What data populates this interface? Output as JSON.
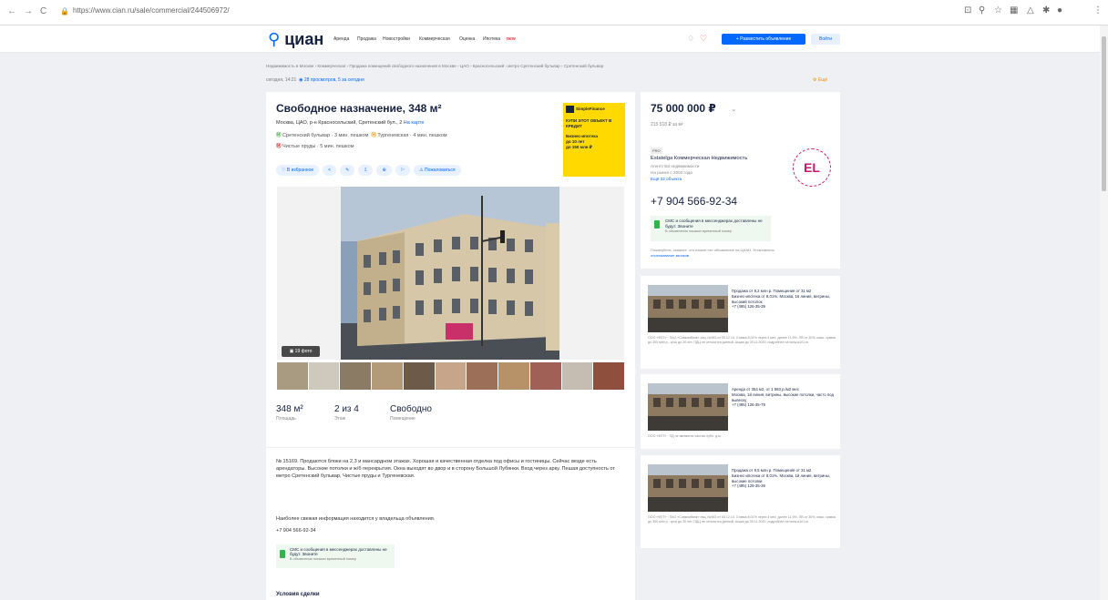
{
  "browser": {
    "url": "https://www.cian.ru/sale/commercial/244506972/",
    "back": "←",
    "forward": "→",
    "reload": "C"
  },
  "header": {
    "logo": "циан",
    "menu": [
      "Аренда",
      "Продажа",
      "Новостройки",
      "Коммерческая",
      "Оценка",
      "Ипотека"
    ],
    "new_badge": "new",
    "post_button": "+ Разместить объявление",
    "login_button": "Войти"
  },
  "breadcrumb": "Недвижимость в Москве › Коммерческая › Продажа помещений свободного назначения в Москве › ЦАО › Красносельский › метро Сретенский бульвар › Сретенский бульвар",
  "meta": {
    "date": "сегодня, 14:21",
    "views": "28 просмотров, 5 за сегодня",
    "favorite": "Ещё"
  },
  "listing": {
    "title": "Свободное назначение, 348 м²",
    "address": "Москва, ЦАО, р-н Красносельский, Сретенский бул., 2",
    "map_link": "На карте",
    "metro": [
      {
        "station": "Сретенский бульвар",
        "time": "· 3 мин. пешком",
        "color": "#4caf50"
      },
      {
        "station": "Тургеневская",
        "time": "· 4 мин. пешком",
        "color": "#f39c12"
      },
      {
        "station": "Чистые пруды",
        "time": "· 5 мин. пешком",
        "color": "#e53935"
      }
    ],
    "actions": [
      "♡ В избранное",
      "<",
      "✎",
      "⇩",
      "⊕",
      "⚐",
      "⚠ Пожаловаться"
    ],
    "photo_count": "▣ 19 фото",
    "facts": [
      {
        "value": "348 м²",
        "label": "Площадь"
      },
      {
        "value": "2 из 4",
        "label": "Этаж"
      },
      {
        "value": "Свободно",
        "label": "Помещение"
      }
    ],
    "description": "№ 15169. Продаются блоки на 2,3 и мансардном этажах. Хорошая и качественная отделка под офисы и гостиницы. Сейчас везде есть арендаторы. Высокие потолки и ж/б перекрытия. Окна выходят во двор и в сторону Большой Лубянки. Вход через арку. Пешая доступность от метро Сретенский бульвар, Чистые пруды и Тургеневская.",
    "fresh_info": "Наиболее свежая информация находится у владельца объявления.",
    "phone": "+7 904 566-92-34",
    "sms_title": "СМС и сообщения в мессенджерах доставлены не будут. Звоните",
    "sms_sub": "В объявлении показан временный номер",
    "deal_heading": "Условия сделки"
  },
  "ad": {
    "brand": "SimpleFinance",
    "line1": "КУПИ ЭТОТ ОБЪЕКТ В КРЕДИТ",
    "line2": "Бизнес-ипотека",
    "line3": "до 10 лет",
    "line4": "до 150 млн ₽"
  },
  "price_card": {
    "price": "75 000 000 ₽",
    "per_m2": "215 518 ₽ за м²",
    "agency_badge": "PRO",
    "agency_name": "Estatelga Коммерческая Недвижимость",
    "agency_type": "Агентство недвижимости",
    "agency_since": "На рынке с 2002 года",
    "agency_more": "Ещё 32 объекта",
    "agency_logo": "EL",
    "phone": "+7 904 566-92-34",
    "sms_title": "СМС и сообщения в мессенджерах доставлены не будут. Звоните",
    "sms_sub": "В объявлении показан временный номер",
    "warn": "Пожалуйста, скажите, что нашли это объявление на ЦИАН. Установлено",
    "warn_link": "отслеживание звонков"
  },
  "promos": [
    {
      "text": "Продажа от 8,2 млн р. Помещения от 31 м2\nБизнес-ипотека от 8,01%. Москва, 16 линия, витрины, высокий потолок\n+7 (495) 126-35-39",
      "fine": "ООО «ФЛТ» · ПАО «Совкомбанк» лиц. №963 от 05.12.14. Ставка 8,01% через 4 мес. далее 11,9%. ПВ от 30%, макс. сумма до 300 млн р., срок до 30 лет. ПДЦ не относится данной. Акция до 30.11.2020, подробнее на www.a101.ru"
    },
    {
      "text": "Аренда от 354 м2, от 1 583 р./м2 мес\nМосква, 1й линия, витрины, высокие потолки, часто под вывеску\n+7 (495) 126-35-79",
      "fine": "ООО «ФЛТ» · ПД не являются частью публ. д.м."
    },
    {
      "text": "Продажа от 8,5 млн р. Помещения от 31 м2\nБизнес-ипотека от 8,01%. Москва, 1й линия, витрины, высокие потолки\n+7 (495) 126-35-39",
      "fine": "ООО «ФЛТ» · ПАО «Совкомбанк» лиц. №963 от 05.12.14. Ставка 8,01% через 4 мес. далее 11,9%. ПВ от 30%, макс. сумма до 300 млн р., срок до 30 лет. ПДЦ не относится данной. Акция до 30.11.2020, подробнее на www.a101.ru"
    }
  ]
}
